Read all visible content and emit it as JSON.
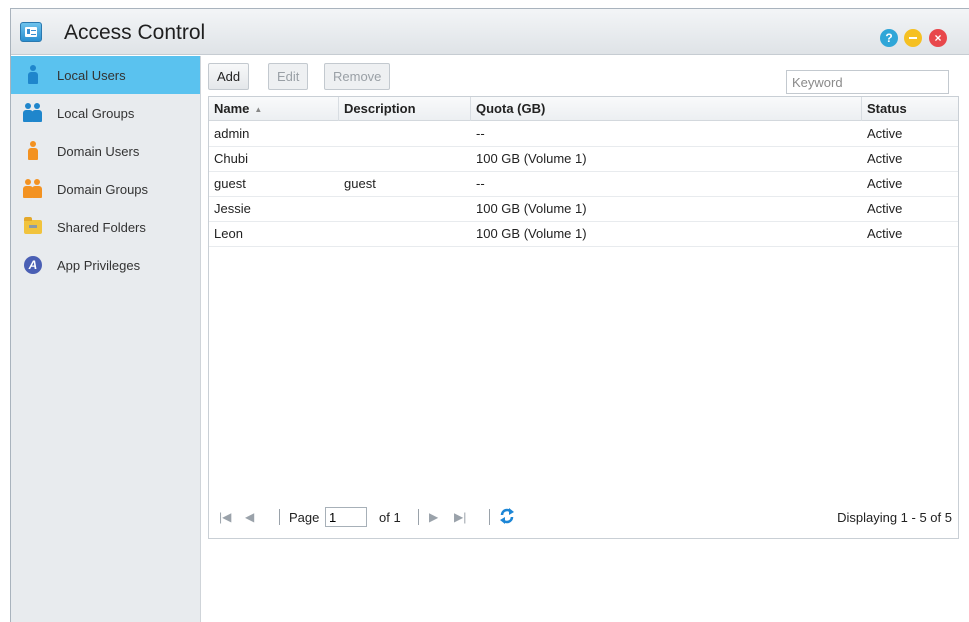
{
  "window": {
    "title": "Access Control"
  },
  "controls": {
    "help": "?",
    "close": "×"
  },
  "sidebar": {
    "items": [
      {
        "label": "Local Users",
        "icon": "local-user-icon",
        "active": true
      },
      {
        "label": "Local Groups",
        "icon": "local-group-icon"
      },
      {
        "label": "Domain Users",
        "icon": "domain-user-icon"
      },
      {
        "label": "Domain Groups",
        "icon": "domain-group-icon"
      },
      {
        "label": "Shared Folders",
        "icon": "shared-folder-icon"
      },
      {
        "label": "App Privileges",
        "icon": "app-privileges-icon",
        "glyph": "A"
      }
    ]
  },
  "toolbar": {
    "add": "Add",
    "edit": "Edit",
    "remove": "Remove",
    "search_placeholder": "Keyword"
  },
  "table": {
    "columns": [
      "Name",
      "Description",
      "Quota (GB)",
      "Status"
    ],
    "sort_indicator": "▲",
    "rows": [
      {
        "name": "admin",
        "description": "",
        "quota": "--",
        "status": "Active"
      },
      {
        "name": "Chubi",
        "description": "",
        "quota": "100 GB (Volume 1)",
        "status": "Active"
      },
      {
        "name": "guest",
        "description": "guest",
        "quota": "--",
        "status": "Active"
      },
      {
        "name": "Jessie",
        "description": "",
        "quota": "100 GB (Volume 1)",
        "status": "Active"
      },
      {
        "name": "Leon",
        "description": "",
        "quota": "100 GB (Volume 1)",
        "status": "Active"
      }
    ]
  },
  "pager": {
    "page_label": "Page",
    "page_value": "1",
    "of_label": "of 1",
    "display_text": "Displaying 1 - 5 of 5"
  }
}
